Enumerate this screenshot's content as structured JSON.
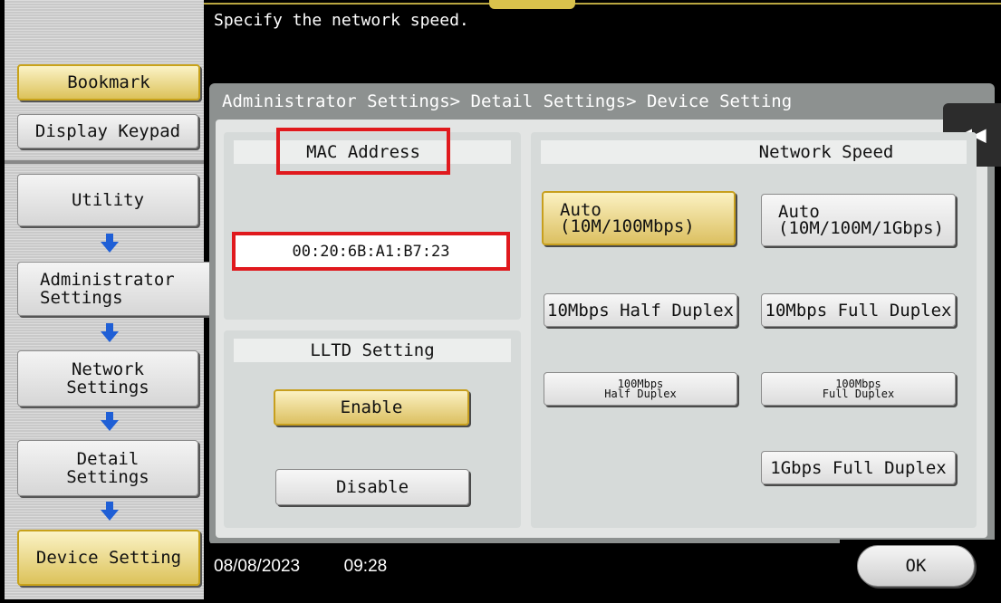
{
  "instruction": "Specify the network speed.",
  "breadcrumb": "Administrator Settings> Detail Settings> Device Setting",
  "sidebar": {
    "bookmark": "Bookmark",
    "display_keypad": "Display Keypad",
    "utility": "Utility",
    "administrator_settings": "Administrator\nSettings",
    "network_settings": "Network\nSettings",
    "detail_settings": "Detail\nSettings",
    "device_setting": "Device Setting"
  },
  "mac": {
    "header": "MAC Address",
    "value": "00:20:6B:A1:B7:23"
  },
  "lltd": {
    "header": "LLTD Setting",
    "enable": "Enable",
    "disable": "Disable",
    "selected": "Enable"
  },
  "network_speed": {
    "header": "Network Speed",
    "auto_100": "Auto\n(10M/100Mbps)",
    "auto_1g": "Auto\n(10M/100M/1Gbps)",
    "half_10": "10Mbps Half Duplex",
    "full_10": "10Mbps Full Duplex",
    "half_100_top": "100Mbps",
    "half_100_bottom": "Half Duplex",
    "full_100_top": "100Mbps",
    "full_100_bottom": "Full Duplex",
    "full_1g": "1Gbps Full Duplex",
    "selected": "Auto (10M/100Mbps)"
  },
  "footer": {
    "date": "08/08/2023",
    "time": "09:28",
    "ok": "OK"
  },
  "colors": {
    "selected_gold": "#dcc25a",
    "highlight_red": "#e0191d",
    "arrow_blue": "#1f5fd6"
  },
  "icons": {
    "flow_arrow": "arrow-down-icon",
    "collapse": "double-chevron-left-icon"
  }
}
